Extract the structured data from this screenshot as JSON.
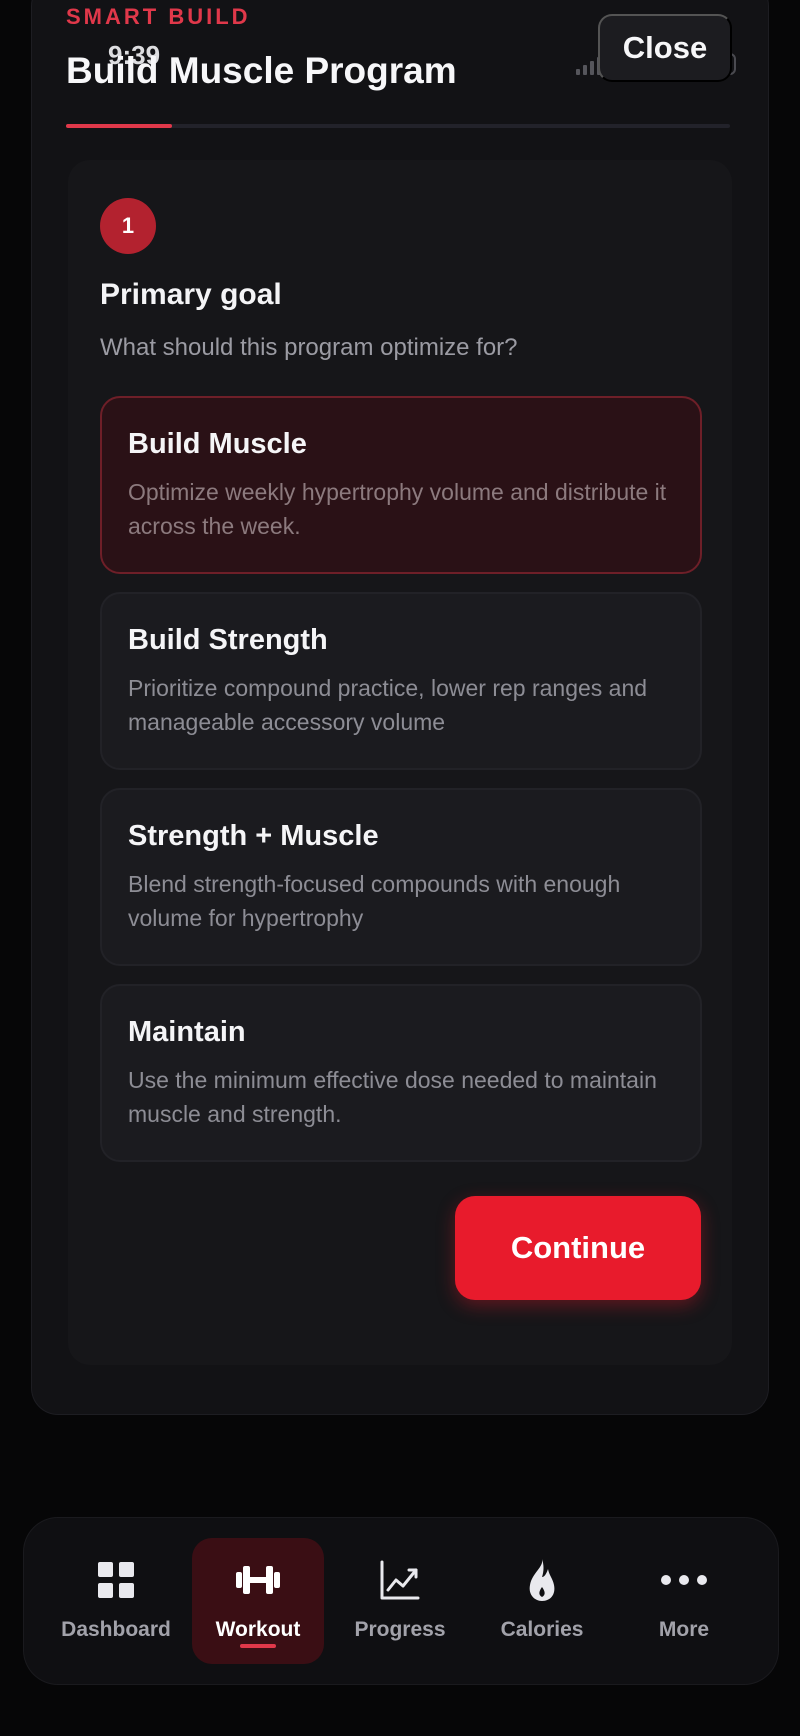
{
  "header": {
    "eyebrow": "SMART BUILD",
    "status_time": "9:39",
    "title": "Build Muscle Program",
    "close_label": "Close",
    "progress": 0.16
  },
  "step": {
    "number": "1",
    "title": "Primary goal",
    "subtitle": "What should this program optimize for?"
  },
  "options": [
    {
      "title": "Build Muscle",
      "desc": "Optimize weekly hypertrophy volume and distribute it across the week.",
      "selected": true
    },
    {
      "title": "Build Strength",
      "desc": "Prioritize compound practice, lower rep ranges and manageable accessory volume",
      "selected": false
    },
    {
      "title": "Strength + Muscle",
      "desc": "Blend strength-focused compounds with enough volume for hypertrophy",
      "selected": false
    },
    {
      "title": "Maintain",
      "desc": "Use the minimum effective dose needed to maintain muscle and strength.",
      "selected": false
    }
  ],
  "continue_label": "Continue",
  "tabs": [
    {
      "label": "Dashboard",
      "icon": "grid-icon",
      "active": false
    },
    {
      "label": "Workout",
      "icon": "dumbbell-icon",
      "active": true
    },
    {
      "label": "Progress",
      "icon": "chart-icon",
      "active": false
    },
    {
      "label": "Calories",
      "icon": "flame-icon",
      "active": false
    },
    {
      "label": "More",
      "icon": "more-icon",
      "active": false
    }
  ],
  "colors": {
    "accent": "#e0384a",
    "button": "#e81b2c",
    "background": "#060607",
    "selected_option": "#2a1116"
  }
}
